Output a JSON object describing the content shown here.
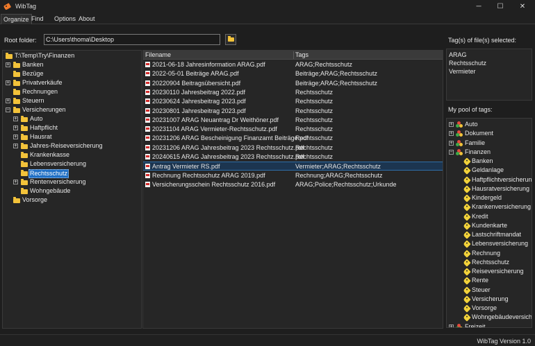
{
  "window": {
    "title": "WibTag"
  },
  "tabs": [
    "Organize",
    "Find",
    "Options",
    "About"
  ],
  "root": {
    "label": "Root folder:",
    "path": "C:\\Users\\thoma\\Desktop"
  },
  "folder_tree": {
    "root": "T:\\Temp\\Try\\Finanzen",
    "level1": [
      "Banken",
      "Bezüge",
      "Privatverkäufe",
      "Rechnungen",
      "Steuern",
      "Versicherungen"
    ],
    "versicherungen": [
      "Auto",
      "Haftpflicht",
      "Hausrat",
      "Jahres-Reiseversicherung",
      "Krankenkasse",
      "Lebensversicherung",
      "Rechtsschutz",
      "Rentenversicherung",
      "Wohngebäude"
    ],
    "last": "Vorsorge",
    "selected": "Rechtsschutz"
  },
  "file_list": {
    "headers": {
      "filename": "Filename",
      "tags": "Tags"
    },
    "rows": [
      {
        "name": "2021-06-18 Jahresinformation ARAG.pdf",
        "tags": "ARAG;Rechtsschutz"
      },
      {
        "name": "2022-05-01 Beiträge ARAG.pdf",
        "tags": "Beiträge;ARAG;Rechtsschutz"
      },
      {
        "name": "20220904 Beitragsübersicht.pdf",
        "tags": "Beiträge;ARAG;Rechtsschutz"
      },
      {
        "name": "20230110 Jahresbeitrag 2022.pdf",
        "tags": "Rechtsschutz"
      },
      {
        "name": "20230624 Jahresbeitrag 2023.pdf",
        "tags": "Rechtsschutz"
      },
      {
        "name": "20230801 Jahresbeitrag 2023.pdf",
        "tags": "Rechtsschutz"
      },
      {
        "name": "20231007 ARAG Neuantrag Dr Weithöner.pdf",
        "tags": "Rechtsschutz"
      },
      {
        "name": "20231104 ARAG Vermieter-Rechtsschutz.pdf",
        "tags": "Rechtsschutz"
      },
      {
        "name": "20231206 ARAG Bescheinigung Finanzamt Beiträge.pdf",
        "tags": "Rechtsschutz"
      },
      {
        "name": "20231206 ARAG Jahresbeitrag 2023 Rechtsschutz.pdf",
        "tags": "Rechtsschutz"
      },
      {
        "name": "20240615 ARAG Jahresbeitrag 2023 Rechtsschutz.pdf",
        "tags": "Rechtsschutz"
      },
      {
        "name": "Antrag Vermieter RS.pdf",
        "tags": "Vermieter;ARAG;Rechtsschutz"
      },
      {
        "name": "Rechnung Rechtsschutz ARAG 2019.pdf",
        "tags": "Rechnung;ARAG;Rechtsschutz"
      },
      {
        "name": "Versicherungsschein Rechtsschutz 2016.pdf",
        "tags": "ARAG;Police;Rechtsschutz;Urkunde"
      }
    ],
    "selected_index": 11
  },
  "selected_tags": {
    "label": "Tag(s) of file(s) selected:",
    "items": [
      "ARAG",
      "Rechtsschutz",
      "Vermieter"
    ]
  },
  "tag_pool": {
    "label": "My pool of tags:",
    "groups_before": [
      "Auto",
      "Dokument",
      "Familie"
    ],
    "expanded_group": "Finanzen",
    "finanzen_tags": [
      "Banken",
      "Geldanlage",
      "Haftpflichtversicherung",
      "Hausratversicherung",
      "Kindergeld",
      "Krankenversicherung",
      "Kredit",
      "Kundenkarte",
      "Lastschriftmandat",
      "Lebensversicherung",
      "Rechnung",
      "Rechtsschutz",
      "Reiseversicherung",
      "Rente",
      "Steuer",
      "Versicherung",
      "Vorsorge",
      "Wohngebäudeversicherung"
    ],
    "groups_after": [
      "Freizeit"
    ]
  },
  "status": {
    "version": "WibTag Version 1.0"
  },
  "icons": {
    "app": "tag-icon",
    "folder": "folder-icon",
    "file": "pdf-file-icon",
    "tag_group": "tag-group-icon",
    "tag": "tag-icon"
  },
  "colors": {
    "selection": "#1f6fc5",
    "folder": "#f2c23a",
    "accent": "#f07a2a"
  }
}
